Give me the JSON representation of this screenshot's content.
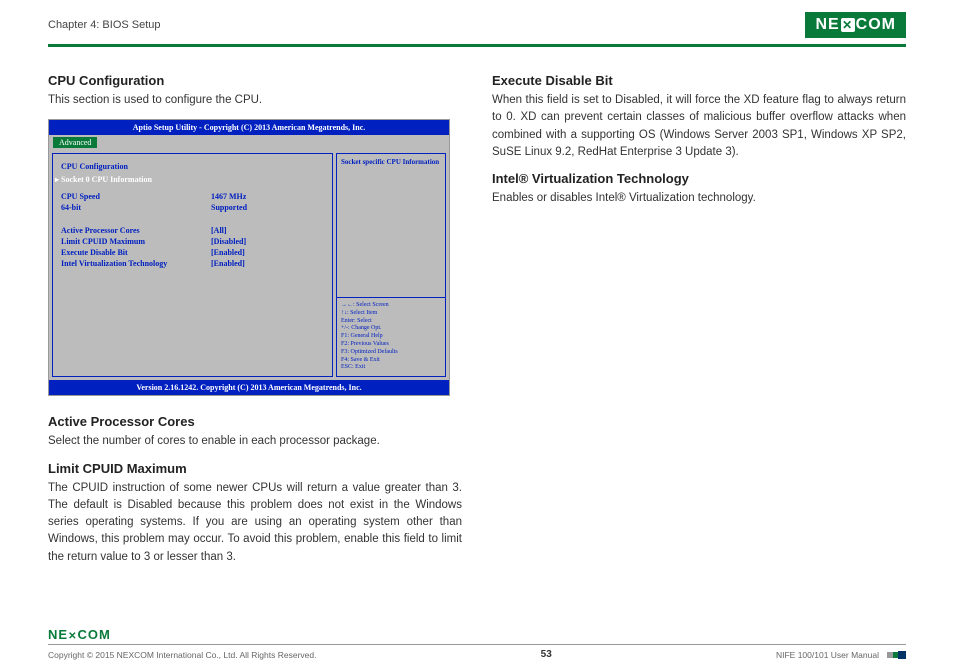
{
  "header": {
    "chapter": "Chapter 4: BIOS Setup",
    "logo_text_pre": "NE",
    "logo_text_post": "COM"
  },
  "left": {
    "title": "CPU Configuration",
    "intro": "This section is used to configure the CPU.",
    "sec1_h": "Active Processor Cores",
    "sec1_p": "Select the number of cores to enable in each processor package.",
    "sec2_h": "Limit CPUID Maximum",
    "sec2_p": "The CPUID instruction of some newer CPUs will return a value greater than 3. The default is Disabled because this problem does not exist in the Windows series operating systems. If you are using an operating system other than Windows, this problem may occur. To avoid this problem, enable this field to limit the return value to 3 or lesser than 3."
  },
  "right": {
    "sec1_h": "Execute Disable Bit",
    "sec1_p": "When this field is set to Disabled, it will force the XD feature flag to always return to 0. XD can prevent certain classes of malicious buffer overflow attacks when combined with a supporting OS (Windows Server 2003 SP1, Windows XP SP2, SuSE Linux 9.2, RedHat Enterprise 3 Update 3).",
    "sec2_h": "Intel® Virtualization Technology",
    "sec2_p": "Enables or disables Intel® Virtualization technology."
  },
  "bios": {
    "titlebar": "Aptio Setup Utility - Copyright (C) 2013 American Megatrends, Inc.",
    "tab_active": "Advanced",
    "heading": "CPU Configuration",
    "socket_line": "Socket 0 CPU Information",
    "rows": {
      "speed_l": "CPU Speed",
      "speed_v": "1467 MHz",
      "bit_l": "64-bit",
      "bit_v": "Supported",
      "apc_l": "Active Processor Cores",
      "apc_v": "[All]",
      "lcm_l": "Limit CPUID Maximum",
      "lcm_v": "[Disabled]",
      "edb_l": "Execute Disable Bit",
      "edb_v": "[Enabled]",
      "ivt_l": "Intel Virtualization Technology",
      "ivt_v": "[Enabled]"
    },
    "help": "Socket specific CPU Information",
    "keys": {
      "k1": "→←: Select Screen",
      "k2": "↑↓: Select Item",
      "k3": "Enter: Select",
      "k4": "+/-: Change Opt.",
      "k5": "F1: General Help",
      "k6": "F2: Previous Values",
      "k7": "F3: Optimized Defaults",
      "k8": "F4: Save & Exit",
      "k9": "ESC: Exit"
    },
    "footer": "Version 2.16.1242. Copyright (C) 2013 American Megatrends, Inc."
  },
  "footer": {
    "copyright": "Copyright © 2015 NEXCOM International Co., Ltd. All Rights Reserved.",
    "page": "53",
    "manual": "NIFE 100/101 User Manual"
  }
}
